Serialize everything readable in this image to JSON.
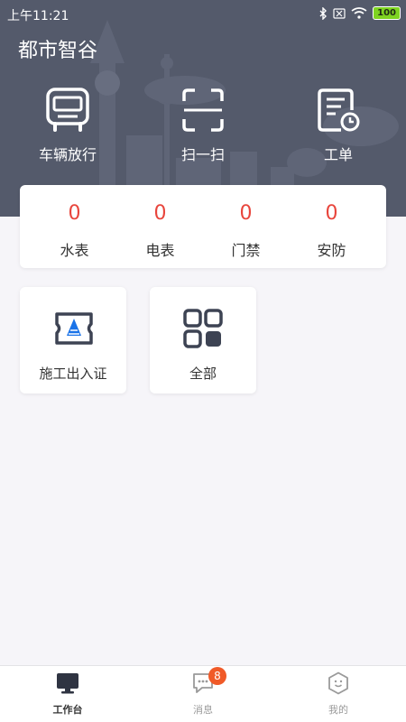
{
  "status_bar": {
    "time": "上午11:21",
    "battery": "100"
  },
  "app": {
    "title": "都市智谷"
  },
  "quick_actions": [
    {
      "label": "车辆放行",
      "icon": "bus-icon"
    },
    {
      "label": "扫一扫",
      "icon": "scan-icon"
    },
    {
      "label": "工单",
      "icon": "work-order-icon"
    }
  ],
  "meters": [
    {
      "count": "0",
      "label": "水表"
    },
    {
      "count": "0",
      "label": "电表"
    },
    {
      "count": "0",
      "label": "门禁"
    },
    {
      "count": "0",
      "label": "安防"
    }
  ],
  "tiles": [
    {
      "label": "施工出入证",
      "icon": "permit-ticket-icon"
    },
    {
      "label": "全部",
      "icon": "all-apps-icon"
    }
  ],
  "tabbar": {
    "items": [
      {
        "label": "工作台",
        "icon": "workbench-icon",
        "active": true
      },
      {
        "label": "消息",
        "icon": "message-icon",
        "badge": "8"
      },
      {
        "label": "我的",
        "icon": "profile-icon"
      }
    ]
  },
  "colors": {
    "header_bg": "#545a6b",
    "accent_red": "#e8453c",
    "badge": "#f05a28",
    "ticket_blue": "#1a73e8"
  }
}
